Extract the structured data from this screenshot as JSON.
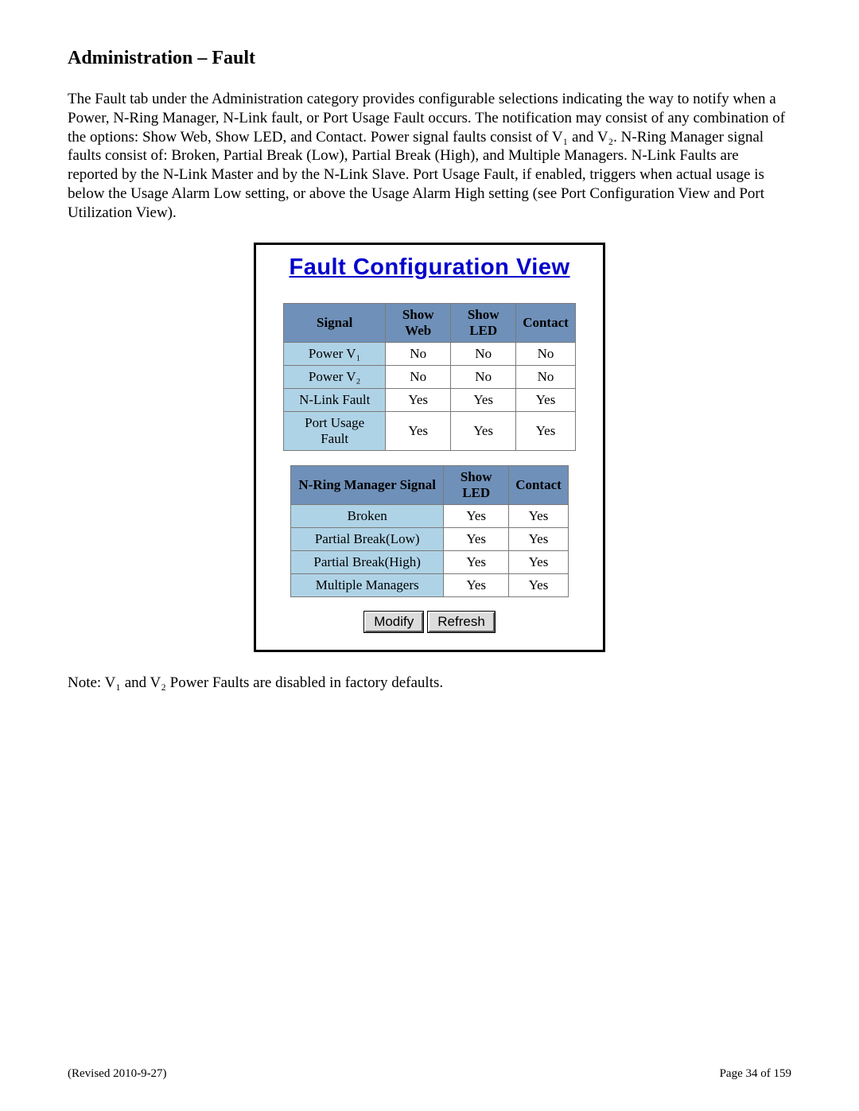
{
  "heading": "Administration – Fault",
  "body_paragraph": "The Fault tab under the Administration category provides configurable selections indicating the way to notify when a Power, N-Ring Manager, N-Link fault, or Port Usage Fault occurs. The notification may consist of any combination of the options: Show Web, Show LED, and Contact. Power signal faults consist of V₁ and V₂. N-Ring Manager signal faults consist of: Broken, Partial Break (Low), Partial Break (High), and Multiple Managers. N-Link Faults are reported by the N-Link Master and by the N-Link Slave. Port Usage Fault, if enabled, triggers when actual usage is below the Usage Alarm Low setting, or above the Usage Alarm High setting (see Port Configuration View and Port Utilization View).",
  "panel": {
    "title": "Fault Configuration View",
    "table1": {
      "headers": [
        "Signal",
        "Show Web",
        "Show LED",
        "Contact"
      ],
      "rows": [
        {
          "signal": "Power V₁",
          "show_web": "No",
          "show_led": "No",
          "contact": "No"
        },
        {
          "signal": "Power V₂",
          "show_web": "No",
          "show_led": "No",
          "contact": "No"
        },
        {
          "signal": "N-Link Fault",
          "show_web": "Yes",
          "show_led": "Yes",
          "contact": "Yes"
        },
        {
          "signal": "Port Usage Fault",
          "show_web": "Yes",
          "show_led": "Yes",
          "contact": "Yes"
        }
      ]
    },
    "table2": {
      "headers": [
        "N-Ring Manager Signal",
        "Show LED",
        "Contact"
      ],
      "rows": [
        {
          "signal": "Broken",
          "show_led": "Yes",
          "contact": "Yes"
        },
        {
          "signal": "Partial Break(Low)",
          "show_led": "Yes",
          "contact": "Yes"
        },
        {
          "signal": "Partial Break(High)",
          "show_led": "Yes",
          "contact": "Yes"
        },
        {
          "signal": "Multiple Managers",
          "show_led": "Yes",
          "contact": "Yes"
        }
      ]
    },
    "buttons": {
      "modify": "Modify",
      "refresh": "Refresh"
    }
  },
  "note": "Note: V₁ and V₂ Power Faults are disabled in factory defaults.",
  "footer": {
    "revised": "(Revised 2010-9-27)",
    "page": "Page 34 of 159"
  }
}
